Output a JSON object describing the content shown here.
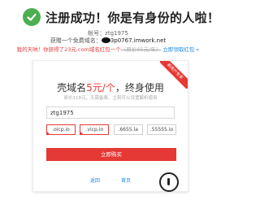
{
  "header": {
    "title": "注册成功！你是有身份的人啦！",
    "account_label": "帐号：",
    "account_value": "ztg1975",
    "domain_prefix": "获赠一个免费域名：",
    "domain_value": "3p0767.imwork.net"
  },
  "promo": {
    "lead": "我的天呐！你获得了23元.com域名红包一个",
    "original_price": "（原价65元/年）",
    "link_text": "立即领取红包 »"
  },
  "card": {
    "ribbon": "新用户专享",
    "offer_prefix": "壳域名",
    "offer_price": "5元/个",
    "offer_suffix": "，终身使用",
    "subtitle": "原价118元，无需备案，立刻可以设置解析使用",
    "input_value": "ztg1975",
    "suffixes": [
      {
        "label": ".oicp.io",
        "selected": true
      },
      {
        "label": ".vicp.io",
        "selected": true
      },
      {
        "label": ".6655.la",
        "selected": false
      },
      {
        "label": ".55555.io",
        "selected": false
      }
    ],
    "buy_label": "立即购买",
    "links": {
      "back": "返回",
      "home": "首页"
    }
  },
  "colors": {
    "accent": "#e53935",
    "success": "#4caf50",
    "link": "#1e88e5"
  },
  "icons": {
    "success": "check-circle-icon",
    "cursor": "mouse-cursor-icon"
  }
}
